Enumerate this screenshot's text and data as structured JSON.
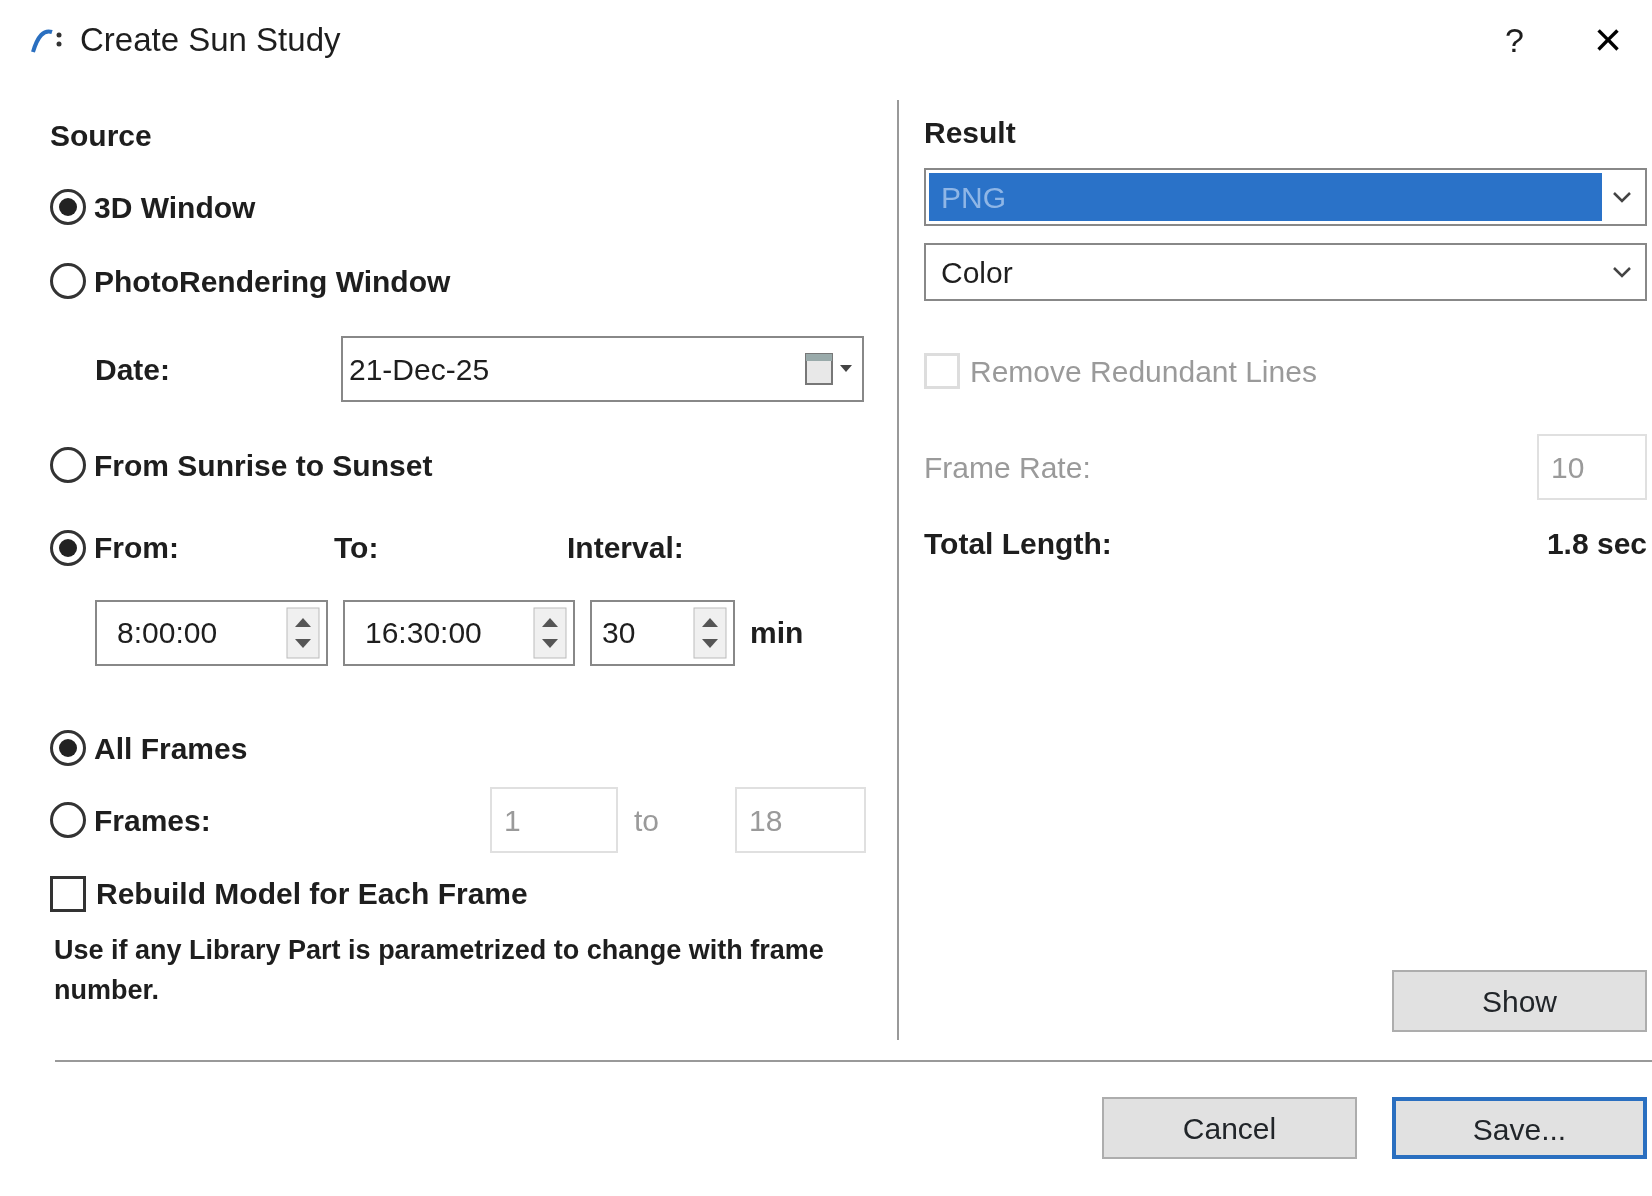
{
  "window": {
    "title": "Create Sun Study",
    "help": "?",
    "close": "×"
  },
  "source": {
    "heading": "Source",
    "options": [
      {
        "label": "3D Window",
        "selected": true
      },
      {
        "label": "PhotoRendering Window",
        "selected": false
      }
    ],
    "date": {
      "label": "Date:",
      "value": "21-Dec-25"
    },
    "time_modes": [
      {
        "label": "From Sunrise to Sunset",
        "selected": false
      },
      {
        "label": "From:",
        "selected": true
      }
    ],
    "to_label": "To:",
    "interval_label": "Interval:",
    "from_value": "8:00:00",
    "to_value": "16:30:00",
    "interval_value": "30",
    "unit": "min",
    "frame_modes": [
      {
        "label": "All Frames",
        "selected": true
      },
      {
        "label": "Frames:",
        "selected": false
      }
    ],
    "frames_range": {
      "disabled": true,
      "from": "1",
      "to_label": "to",
      "to": "18"
    },
    "rebuild": {
      "label": "Rebuild Model for Each Frame",
      "checked": false
    },
    "note": "Use if any Library Part is parametrized to change with frame number."
  },
  "result": {
    "heading": "Result",
    "format": {
      "value": "PNG",
      "highlighted": true
    },
    "color_mode": {
      "value": "Color"
    },
    "remove_redundant": {
      "label": "Remove Redundant Lines",
      "checked": false,
      "disabled": true
    },
    "frame_rate": {
      "label": "Frame Rate:",
      "value": "10",
      "disabled": true
    },
    "total_length": {
      "label": "Total Length:",
      "value": "1.8 sec"
    },
    "show_button": "Show"
  },
  "buttons": [
    {
      "label": "Cancel",
      "default": false
    },
    {
      "label": "Save...",
      "default": true
    }
  ]
}
